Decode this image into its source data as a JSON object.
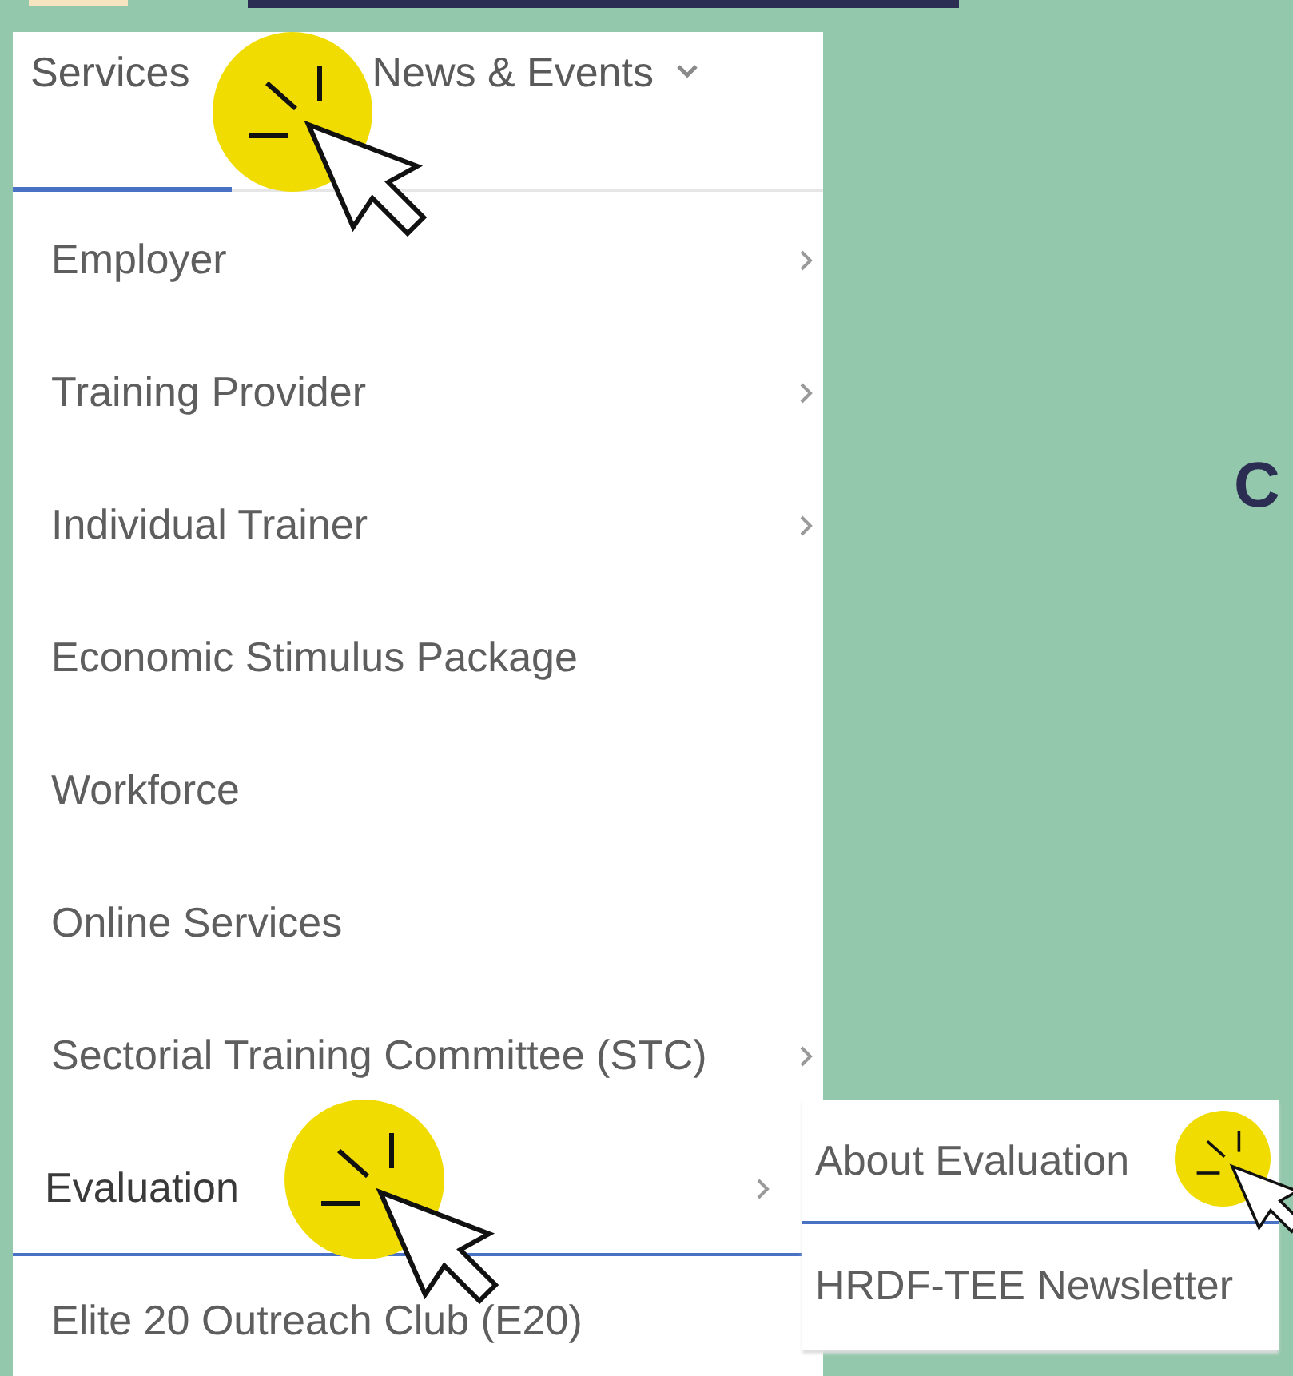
{
  "nav": [
    {
      "label": "Services",
      "selected": true,
      "dropdown": false
    },
    {
      "label": "News & Events",
      "selected": false,
      "dropdown": true
    }
  ],
  "menu": [
    {
      "label": "Employer",
      "submenu": true,
      "selected": false
    },
    {
      "label": "Training Provider",
      "submenu": true,
      "selected": false
    },
    {
      "label": "Individual Trainer",
      "submenu": true,
      "selected": false
    },
    {
      "label": "Economic Stimulus Package",
      "submenu": false,
      "selected": false
    },
    {
      "label": "Workforce",
      "submenu": false,
      "selected": false
    },
    {
      "label": "Online Services",
      "submenu": false,
      "selected": false
    },
    {
      "label": "Sectorial Training Committee (STC)",
      "submenu": true,
      "selected": false
    },
    {
      "label": "Evaluation",
      "submenu": true,
      "selected": true
    },
    {
      "label": "Elite 20 Outreach Club (E20)",
      "submenu": false,
      "selected": false
    }
  ],
  "submenu": [
    {
      "label": "About Evaluation",
      "selected": true
    },
    {
      "label": "HRDF-TEE Newsletter",
      "selected": false
    }
  ],
  "side_text": "C"
}
